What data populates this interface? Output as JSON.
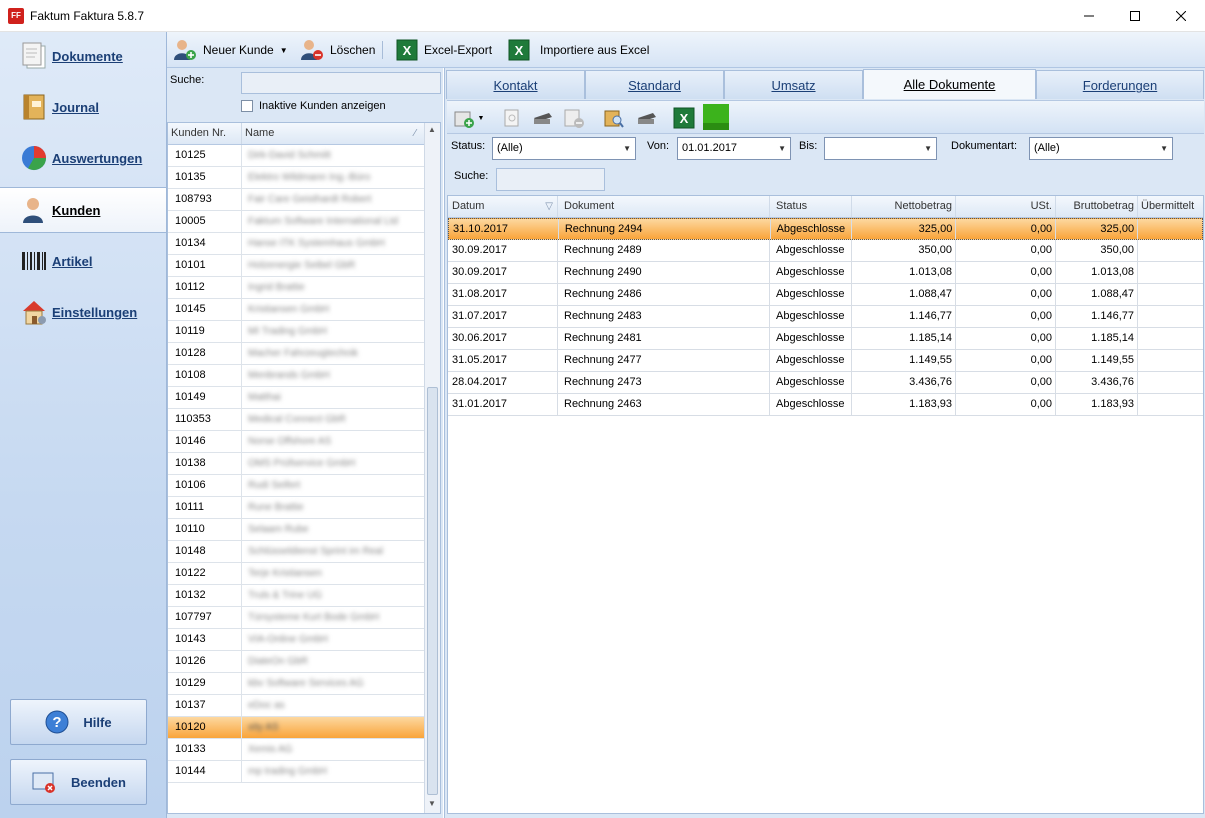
{
  "window": {
    "title": "Faktum Faktura 5.8.7",
    "icon_text": "FF"
  },
  "nav": {
    "items": [
      {
        "label": "Dokumente",
        "icon": "documents-icon"
      },
      {
        "label": "Journal",
        "icon": "journal-icon"
      },
      {
        "label": "Auswertungen",
        "icon": "pie-chart-icon"
      },
      {
        "label": "Kunden",
        "icon": "customer-icon",
        "active": true
      },
      {
        "label": "Artikel",
        "icon": "barcode-icon"
      },
      {
        "label": "Einstellungen",
        "icon": "house-icon"
      }
    ],
    "help_label": "Hilfe",
    "exit_label": "Beenden"
  },
  "toolbar": {
    "new_customer": "Neuer Kunde",
    "delete": "Löschen",
    "excel_export": "Excel-Export",
    "import_excel": "Importiere aus Excel"
  },
  "customers": {
    "search_label": "Suche:",
    "search_value": "",
    "inactive_label": "Inaktive Kunden anzeigen",
    "columns": [
      "Kunden Nr.",
      "Name"
    ],
    "rows": [
      {
        "nr": "10125",
        "name": "Dirk-David Schmitt"
      },
      {
        "nr": "10135",
        "name": "Elektro Wildmann Ing.-Büro"
      },
      {
        "nr": "108793",
        "name": "Fair Care Geisthardt Robert"
      },
      {
        "nr": "10005",
        "name": "Faktum Software International Ltd"
      },
      {
        "nr": "10134",
        "name": "Hanse ITK Systemhaus GmbH"
      },
      {
        "nr": "10101",
        "name": "Holzenergie Seibel GbR"
      },
      {
        "nr": "10112",
        "name": "Ingrid Brattie"
      },
      {
        "nr": "10145",
        "name": "Kristiansen GmbH"
      },
      {
        "nr": "10119",
        "name": "MI Trading GmbH"
      },
      {
        "nr": "10128",
        "name": "Macher Fahrzeugtechnik"
      },
      {
        "nr": "10108",
        "name": "Menbrands GmbH"
      },
      {
        "nr": "10149",
        "name": "Matthai"
      },
      {
        "nr": "110353",
        "name": "Medical Connect GbR"
      },
      {
        "nr": "10146",
        "name": "Norse Offshore AS"
      },
      {
        "nr": "10138",
        "name": "OMS Prüfservice GmbH"
      },
      {
        "nr": "10106",
        "name": "Rudi Seifert"
      },
      {
        "nr": "10111",
        "name": "Rune Brattie"
      },
      {
        "nr": "10110",
        "name": "Selaam Rube"
      },
      {
        "nr": "10148",
        "name": "Schlüsseldienst Sprint im Real"
      },
      {
        "nr": "10122",
        "name": "Terje Kristiansen"
      },
      {
        "nr": "10132",
        "name": "Truls & Trine UG"
      },
      {
        "nr": "107797",
        "name": "Türsysteme Kurt Bode GmbH"
      },
      {
        "nr": "10143",
        "name": "VIA-Online GmbH"
      },
      {
        "nr": "10126",
        "name": "DiateOn GbR"
      },
      {
        "nr": "10129",
        "name": "kbv Software Services AG"
      },
      {
        "nr": "10137",
        "name": "eDoc as"
      },
      {
        "nr": "10120",
        "name": "xity AS",
        "selected": true
      },
      {
        "nr": "10133",
        "name": "Xemis AG"
      },
      {
        "nr": "10144",
        "name": "mp trading GmbH"
      }
    ]
  },
  "tabs": [
    {
      "label": "Kontakt"
    },
    {
      "label": "Standard"
    },
    {
      "label": "Umsatz"
    },
    {
      "label": "Alle Dokumente",
      "active": true
    },
    {
      "label": "Forderungen"
    }
  ],
  "filters": {
    "status_label": "Status:",
    "status_value": "(Alle)",
    "from_label": "Von:",
    "from_value": "01.01.2017",
    "to_label": "Bis:",
    "to_value": "",
    "doctype_label": "Dokumentart:",
    "doctype_value": "(Alle)",
    "search_label": "Suche:",
    "search_value": ""
  },
  "documents": {
    "columns": [
      "Datum",
      "Dokument",
      "Status",
      "Nettobetrag",
      "USt.",
      "Bruttobetrag",
      "Übermittelt"
    ],
    "rows": [
      {
        "date": "31.10.2017",
        "doc": "Rechnung 2494",
        "status": "Abgeschlosse",
        "net": "325,00",
        "vat": "0,00",
        "gross": "325,00",
        "sent": "",
        "selected": true
      },
      {
        "date": "30.09.2017",
        "doc": "Rechnung 2489",
        "status": "Abgeschlosse",
        "net": "350,00",
        "vat": "0,00",
        "gross": "350,00",
        "sent": ""
      },
      {
        "date": "30.09.2017",
        "doc": "Rechnung 2490",
        "status": "Abgeschlosse",
        "net": "1.013,08",
        "vat": "0,00",
        "gross": "1.013,08",
        "sent": ""
      },
      {
        "date": "31.08.2017",
        "doc": "Rechnung 2486",
        "status": "Abgeschlosse",
        "net": "1.088,47",
        "vat": "0,00",
        "gross": "1.088,47",
        "sent": ""
      },
      {
        "date": "31.07.2017",
        "doc": "Rechnung 2483",
        "status": "Abgeschlosse",
        "net": "1.146,77",
        "vat": "0,00",
        "gross": "1.146,77",
        "sent": ""
      },
      {
        "date": "30.06.2017",
        "doc": "Rechnung 2481",
        "status": "Abgeschlosse",
        "net": "1.185,14",
        "vat": "0,00",
        "gross": "1.185,14",
        "sent": ""
      },
      {
        "date": "31.05.2017",
        "doc": "Rechnung 2477",
        "status": "Abgeschlosse",
        "net": "1.149,55",
        "vat": "0,00",
        "gross": "1.149,55",
        "sent": ""
      },
      {
        "date": "28.04.2017",
        "doc": "Rechnung 2473",
        "status": "Abgeschlosse",
        "net": "3.436,76",
        "vat": "0,00",
        "gross": "3.436,76",
        "sent": ""
      },
      {
        "date": "31.01.2017",
        "doc": "Rechnung 2463",
        "status": "Abgeschlosse",
        "net": "1.183,93",
        "vat": "0,00",
        "gross": "1.183,93",
        "sent": ""
      }
    ]
  },
  "colors": {
    "accent": "#1b3f76",
    "selection": "#f9a43a",
    "panel": "#dbe7f5"
  }
}
